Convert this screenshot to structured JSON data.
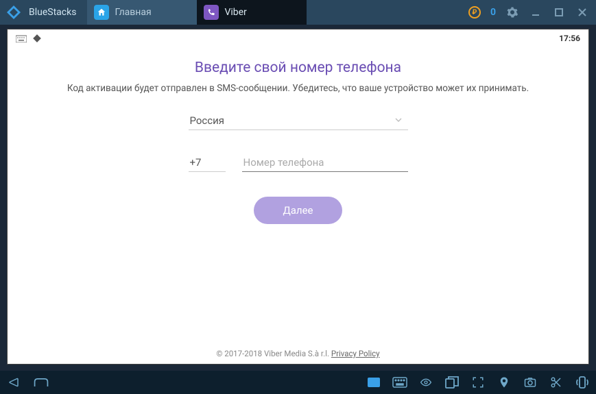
{
  "titlebar": {
    "app_name": "BlueStacks",
    "tabs": [
      {
        "label": "Главная",
        "icon": "home",
        "active": false
      },
      {
        "label": "Viber",
        "icon": "viber",
        "active": true
      }
    ],
    "coins": "0"
  },
  "statusbar": {
    "time": "17:56"
  },
  "viber": {
    "title": "Введите свой номер телефона",
    "subtitle": "Код активации будет отправлен в SMS-сообщении. Убедитесь, что ваше устройство может их принимать.",
    "country": "Россия",
    "country_code": "+7",
    "phone_placeholder": "Номер телефона",
    "next_label": "Далее",
    "footer_copyright": "© 2017-2018 Viber Media S.à r.l. ",
    "footer_link": "Privacy Policy"
  }
}
